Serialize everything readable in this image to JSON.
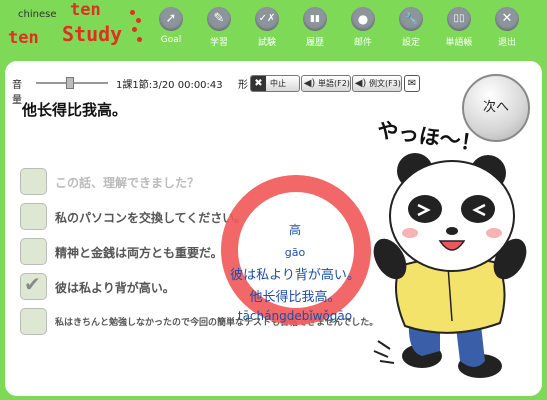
{
  "logo": {
    "chinese": "chinese",
    "ten1": "ten",
    "ten2": "ten",
    "study": "Study"
  },
  "nav": [
    {
      "label": "Goal",
      "icon": "arrow-icon",
      "glyph": "➚"
    },
    {
      "label": "学習",
      "icon": "pencil-icon",
      "glyph": "✎"
    },
    {
      "label": "試験",
      "icon": "check-icon",
      "glyph": "✓✗"
    },
    {
      "label": "履歴",
      "icon": "chart-icon",
      "glyph": "▮▮"
    },
    {
      "label": "邮件",
      "icon": "person-icon",
      "glyph": "●"
    },
    {
      "label": "設定",
      "icon": "wrench-icon",
      "glyph": "🔧"
    },
    {
      "label": "単語帳",
      "icon": "book-icon",
      "glyph": "▯▯"
    },
    {
      "label": "退出",
      "icon": "close-icon",
      "glyph": "✕"
    }
  ],
  "toolbar": {
    "volume_label": "音量",
    "progress": "1課1節:3/20 00:00:43",
    "shape_label": "形",
    "stop_label": "中止",
    "word_label": "単語(F2)",
    "example_label": "例文(F3)"
  },
  "sentence": "他长得比我高。",
  "next_label": "次へ",
  "options": [
    {
      "text": "この話、理解できました？",
      "checked": false
    },
    {
      "text": "私のパソコンを交換してください。",
      "checked": false
    },
    {
      "text": "精神と金銭は両方とも重要だ。",
      "checked": false
    },
    {
      "text": "彼は私より背が高い。",
      "checked": true
    },
    {
      "text": "私はきちんと勉強しなかったので今回の簡単なテストも合格できませんでした。",
      "checked": false
    }
  ],
  "popup": {
    "hanzi": "高",
    "pinyin": "gāo",
    "japanese": "彼は私より背が高い。",
    "chinese": "他长得比我高。",
    "sentence_pinyin": "tāchángdebǐwǒgāo"
  },
  "mascot_text": "やっほ〜！"
}
